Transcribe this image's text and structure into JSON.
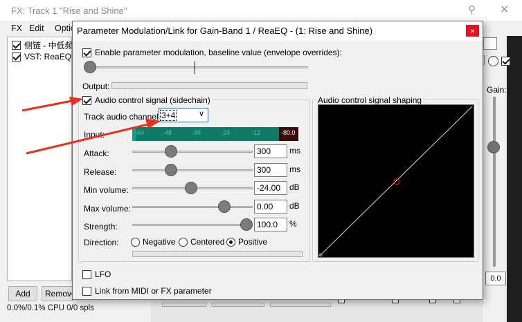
{
  "fx_window": {
    "title": "FX: Track 1 \"Rise and Shine\"",
    "menu": [
      "FX",
      "Edit",
      "Optio"
    ],
    "fx_items": [
      {
        "label": "侧链 - 中低频",
        "checked": true
      },
      {
        "label": "VST: ReaEQ (",
        "checked": true
      }
    ],
    "add_label": "Add",
    "remove_label": "Remove",
    "status": "0.0%/0.1% CPU 0/0 spls",
    "gain_label": "Gain:",
    "gain_value": "0.0",
    "partial_right_text": "ase"
  },
  "dialog": {
    "title": "Parameter Modulation/Link for Gain-Band 1 / ReaEQ - (1: Rise and Shine)",
    "close_glyph": "×",
    "enable_label": "Enable parameter modulation, baseline value (envelope overrides):",
    "enable_checked": true,
    "baseline_fraction": 0.03,
    "output_label": "Output:",
    "acs_label": "Audio control signal (sidechain)",
    "acs_checked": true,
    "track_channel_label": "Track audio channel:",
    "track_channel_value": "3+4",
    "input_label": "Input:",
    "meter_scale": [
      "-60",
      "-48",
      "-36",
      "-24",
      "-12",
      "-80.0"
    ],
    "params": [
      {
        "label": "Attack:",
        "value": "300",
        "unit": "ms",
        "fraction": 0.32
      },
      {
        "label": "Release:",
        "value": "300",
        "unit": "ms",
        "fraction": 0.32
      },
      {
        "label": "Min volume:",
        "value": "-24.00",
        "unit": "dB",
        "fraction": 0.5
      },
      {
        "label": "Max volume:",
        "value": "0.00",
        "unit": "dB",
        "fraction": 0.8
      },
      {
        "label": "Strength:",
        "value": "100.0",
        "unit": "%",
        "fraction": 1.0
      }
    ],
    "direction_label": "Direction:",
    "direction_options": [
      "Negative",
      "Centered",
      "Positive"
    ],
    "direction_selected": "Positive",
    "shaping_label": "Audio control signal shaping",
    "lfo_label": "LFO",
    "lfo_checked": false,
    "midi_link_label": "Link from MIDI or FX parameter",
    "midi_link_checked": false
  },
  "colors": {
    "arrow": "#e8301c",
    "meter_fill": "#0e7a66",
    "meter_peak": "#3a0a0a",
    "close_button": "#e81123",
    "shaping_bg": "#000000",
    "shaping_line": "#d9d9d9",
    "shaping_point": "#e01414"
  }
}
